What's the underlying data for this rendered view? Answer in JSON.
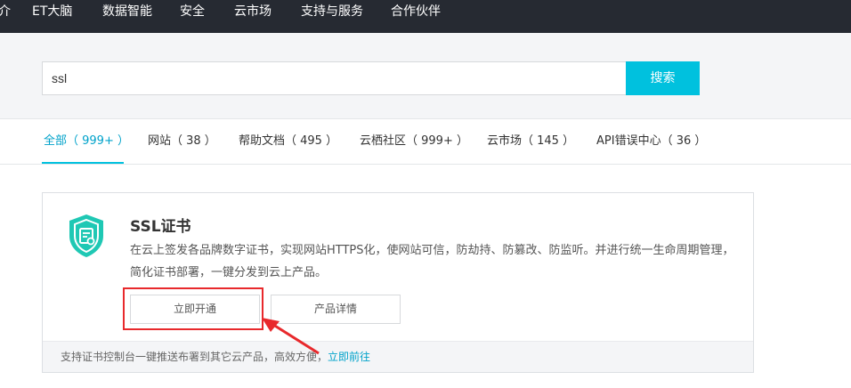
{
  "topnav": {
    "items": [
      "介",
      "ET大脑",
      "数据智能",
      "安全",
      "云市场",
      "支持与服务",
      "合作伙伴"
    ]
  },
  "search": {
    "value": "ssl",
    "button_label": "搜索"
  },
  "tabs": [
    {
      "label": "全部（ 999+ ）"
    },
    {
      "label": "网站（ 38 ）"
    },
    {
      "label": "帮助文档（ 495 ）"
    },
    {
      "label": "云栖社区（ 999+ ）"
    },
    {
      "label": "云市场（ 145 ）"
    },
    {
      "label": "API错误中心（ 36 ）"
    }
  ],
  "result": {
    "title": "SSL证书",
    "description": "在云上签发各品牌数字证书，实现网站HTTPS化，使网站可信，防劫持、防篡改、防监听。并进行统一生命周期管理，简化证书部署，一键分发到云上产品。",
    "open_button": "立即开通",
    "detail_button": "产品详情",
    "footer_text": "支持证书控制台一键推送布署到其它云产品，高效方便，",
    "footer_link": "立即前往",
    "logo_icon": "shield-certificate-icon"
  },
  "colors": {
    "nav_bg": "#262a32",
    "accent": "#00c1de",
    "link": "#00a2ca",
    "annotation": "#e8292c"
  }
}
